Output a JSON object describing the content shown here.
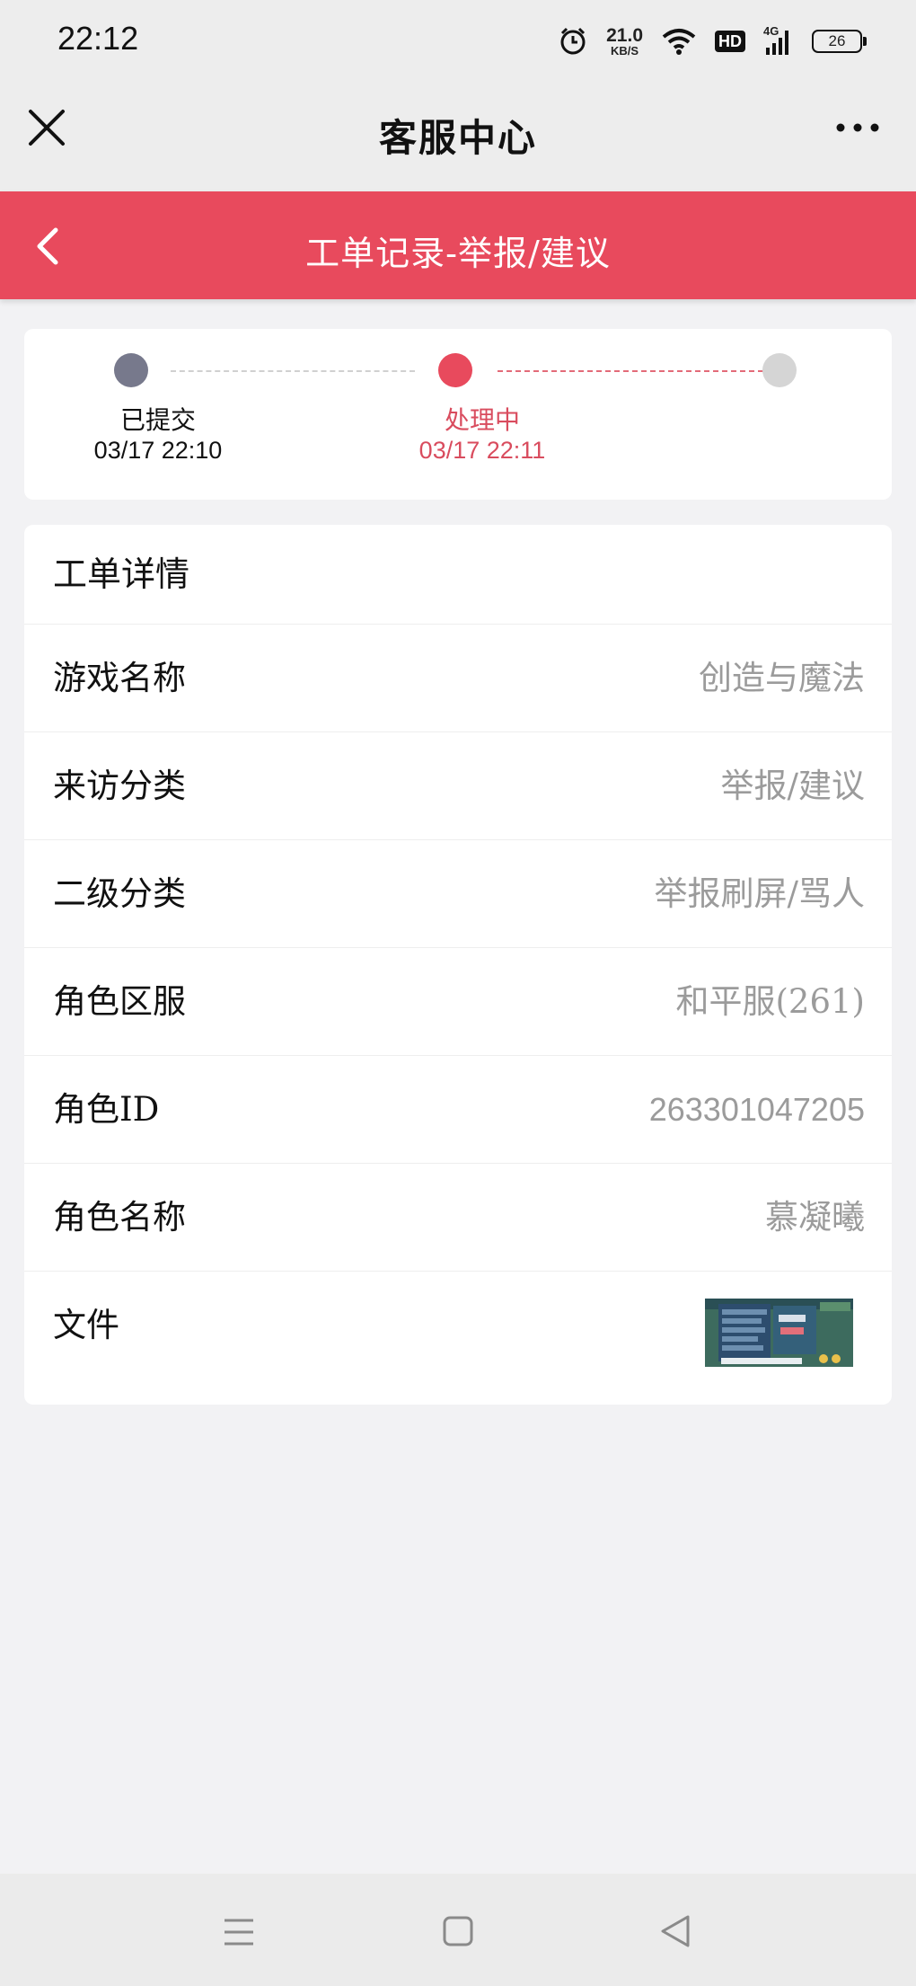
{
  "status_bar": {
    "time": "22:12",
    "speed_value": "21.0",
    "speed_unit": "KB/S",
    "hd_label": "HD",
    "network_label": "4G",
    "battery": "26"
  },
  "nav": {
    "title": "客服中心"
  },
  "header": {
    "title": "工单记录-举报/建议"
  },
  "progress": {
    "steps": [
      {
        "label": "已提交",
        "time": "03/17 22:10"
      },
      {
        "label": "处理中",
        "time": "03/17 22:11"
      }
    ],
    "colors": {
      "done": "#77798c",
      "active": "#e84a5d",
      "pending": "#d5d5d5"
    }
  },
  "detail": {
    "title": "工单详情",
    "rows": [
      {
        "label": "游戏名称",
        "value": "创造与魔法"
      },
      {
        "label": "来访分类",
        "value": "举报/建议"
      },
      {
        "label": "二级分类",
        "value": "举报刷屏/骂人"
      },
      {
        "label": "角色区服",
        "value": "和平服(261)"
      },
      {
        "label": "角色ID",
        "value": "263301047205"
      },
      {
        "label": "角色名称",
        "value": "慕凝曦"
      },
      {
        "label": "文件"
      }
    ]
  },
  "theme": {
    "accent": "#e84a5d"
  },
  "icons": [
    "close-icon",
    "more-icon",
    "back-chevron-icon",
    "alarm-icon",
    "wifi-icon",
    "signal-icon",
    "battery-icon",
    "menu-lines-icon",
    "home-square-icon",
    "back-triangle-icon"
  ]
}
